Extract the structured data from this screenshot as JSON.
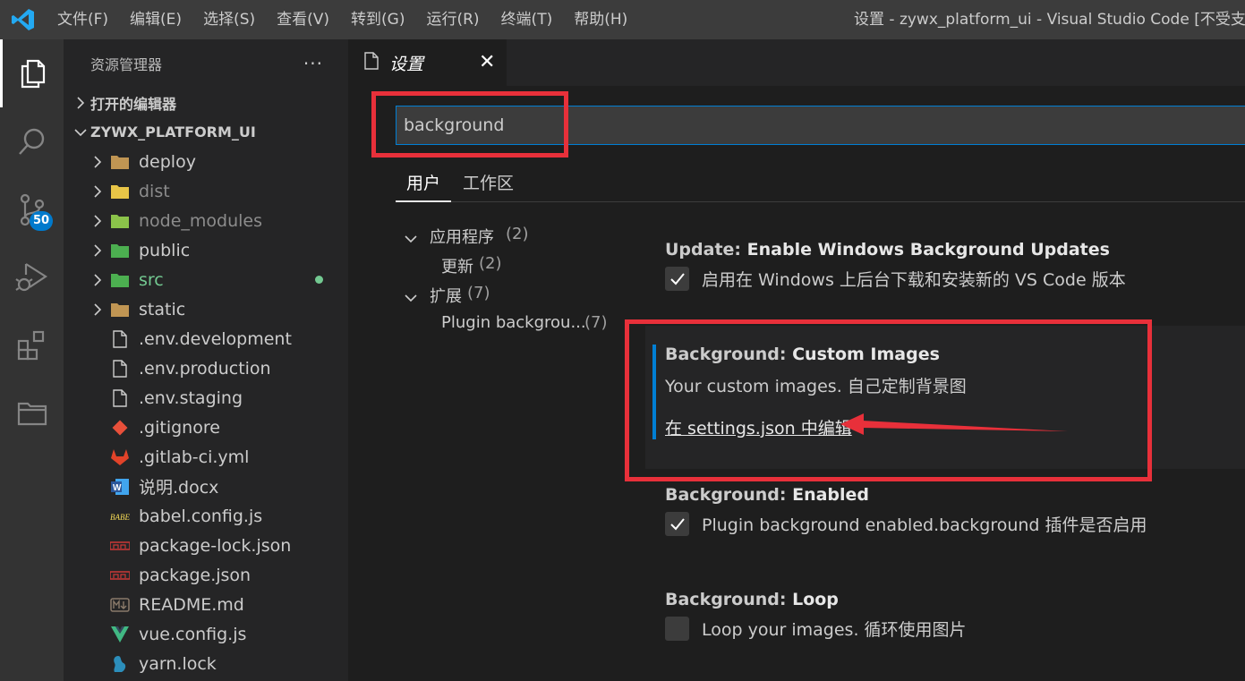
{
  "titlebar": {
    "menu": [
      "文件(F)",
      "编辑(E)",
      "选择(S)",
      "查看(V)",
      "转到(G)",
      "运行(R)",
      "终端(T)",
      "帮助(H)"
    ],
    "window_title": "设置 - zywx_platform_ui - Visual Studio Code [不受支持]"
  },
  "activitybar": {
    "icons": [
      "explorer-icon",
      "search-icon",
      "source-control-icon",
      "run-debug-icon",
      "extensions-icon",
      "folder-icon"
    ],
    "scm_badge": "50"
  },
  "sidebar": {
    "title": "资源管理器",
    "more": "···",
    "open_editors": "打开的编辑器",
    "project": "ZYWX_PLATFORM_UI",
    "items": [
      {
        "name": "deploy",
        "icon": "folder-icon",
        "color": "#c09553"
      },
      {
        "name": "dist",
        "icon": "folder-dist-icon",
        "color": "#e8c547"
      },
      {
        "name": "node_modules",
        "icon": "folder-node-icon",
        "color": "#8bc34a"
      },
      {
        "name": "public",
        "icon": "folder-public-icon",
        "color": "#4caf50"
      },
      {
        "name": "src",
        "icon": "folder-src-icon",
        "color": "#4caf50"
      },
      {
        "name": "static",
        "icon": "folder-icon",
        "color": "#c09553"
      },
      {
        "name": ".env.development",
        "icon": "file-icon"
      },
      {
        "name": ".env.production",
        "icon": "file-icon"
      },
      {
        "name": ".env.staging",
        "icon": "file-icon"
      },
      {
        "name": ".gitignore",
        "icon": "git-icon",
        "color": "#e8503a"
      },
      {
        "name": ".gitlab-ci.yml",
        "icon": "gitlab-icon",
        "color": "#e24329"
      },
      {
        "name": "说明.docx",
        "icon": "word-icon",
        "color": "#2b579a"
      },
      {
        "name": "babel.config.js",
        "icon": "babel-icon",
        "color": "#f5da55"
      },
      {
        "name": "package-lock.json",
        "icon": "npm-icon",
        "color": "#cb3837"
      },
      {
        "name": "package.json",
        "icon": "npm-icon",
        "color": "#cb3837"
      },
      {
        "name": "README.md",
        "icon": "markdown-icon",
        "color": "#8a7a6a"
      },
      {
        "name": "vue.config.js",
        "icon": "vue-icon",
        "color": "#41b883"
      },
      {
        "name": "yarn.lock",
        "icon": "yarn-icon",
        "color": "#2c8ebb"
      }
    ]
  },
  "tab": {
    "label": "设置",
    "close": "✕"
  },
  "settings": {
    "search_value": "background",
    "scope_tabs": [
      "用户",
      "工作区"
    ],
    "toc": [
      {
        "label": "应用程序",
        "count": "(2)",
        "level": 0
      },
      {
        "label": "更新",
        "count": "(2)",
        "level": 1
      },
      {
        "label": "扩展",
        "count": "(7)",
        "level": 0
      },
      {
        "label": "Plugin backgrou...",
        "count": "(7)",
        "level": 1
      }
    ],
    "items": [
      {
        "category": "Update: ",
        "name": "Enable Windows Background Updates",
        "desc": "启用在 Windows 上后台下载和安装新的 VS Code 版本",
        "checked": true
      },
      {
        "category": "Background: ",
        "name": "Custom Images",
        "desc": "Your custom images. 自己定制背景图",
        "link": "在 settings.json 中编辑"
      },
      {
        "category": "Background: ",
        "name": "Enabled",
        "desc": "Plugin background enabled.background 插件是否启用",
        "checked": true
      },
      {
        "category": "Background: ",
        "name": "Loop",
        "desc": "Loop your images. 循环使用图片",
        "checked": false
      }
    ]
  },
  "accent": {
    "red": "#e8303a",
    "blue": "#007acc"
  }
}
